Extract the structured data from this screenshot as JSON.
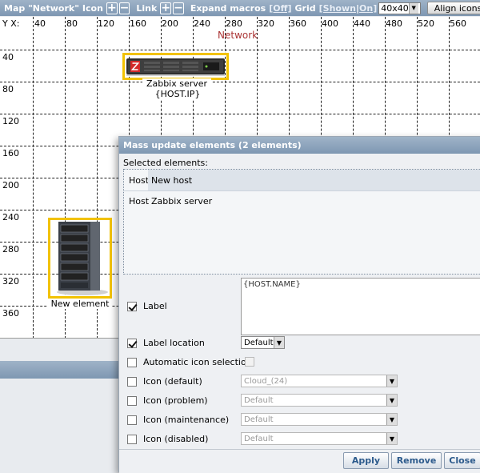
{
  "toolbar": {
    "map_title": "Map \"Network\"",
    "icon_label": "Icon",
    "link_label": "Link",
    "plus_icon": "+",
    "minus_icon": "−",
    "expand_macros_label": "Expand macros",
    "expand_macros_value": "[Off]",
    "grid_label": "Grid",
    "grid_shown": "[Shown",
    "grid_sep": "|",
    "grid_on": "On]",
    "grid_size": "40x40",
    "align_icons": "Align icons",
    "dropdown_arrow": "▼"
  },
  "map": {
    "axis_label": "Y X:",
    "x_ticks": [
      "40",
      "80",
      "120",
      "160",
      "200",
      "240",
      "280",
      "320",
      "360",
      "400",
      "440",
      "480",
      "520",
      "560"
    ],
    "y_ticks": [
      "40",
      "80",
      "120",
      "160",
      "200",
      "240",
      "280",
      "320",
      "360"
    ],
    "title": "Network",
    "elements": [
      {
        "label": "Zabbix server",
        "sublabel": "{HOST.IP}",
        "icon": "rack-server-icon"
      },
      {
        "label": "New element",
        "icon": "tower-server-icon"
      }
    ]
  },
  "dialog": {
    "title": "Mass update elements  (2 elements)",
    "selected_caption": "Selected elements:",
    "selected": [
      {
        "type": "Host",
        "name": "New host"
      },
      {
        "type": "Host",
        "name": "Zabbix server"
      }
    ],
    "fields": {
      "label": {
        "text": "Label",
        "checked": true,
        "value": "{HOST.NAME}"
      },
      "label_location": {
        "text": "Label location",
        "checked": true,
        "value": "Default"
      },
      "auto_icon": {
        "text": "Automatic icon selection",
        "checked": false
      },
      "icon_default": {
        "text": "Icon (default)",
        "checked": false,
        "value": "Cloud_(24)"
      },
      "icon_problem": {
        "text": "Icon (problem)",
        "checked": false,
        "value": "Default"
      },
      "icon_maintenance": {
        "text": "Icon (maintenance)",
        "checked": false,
        "value": "Default"
      },
      "icon_disabled": {
        "text": "Icon (disabled)",
        "checked": false,
        "value": "Default"
      }
    },
    "buttons": {
      "apply": "Apply",
      "remove": "Remove",
      "close": "Close"
    }
  }
}
